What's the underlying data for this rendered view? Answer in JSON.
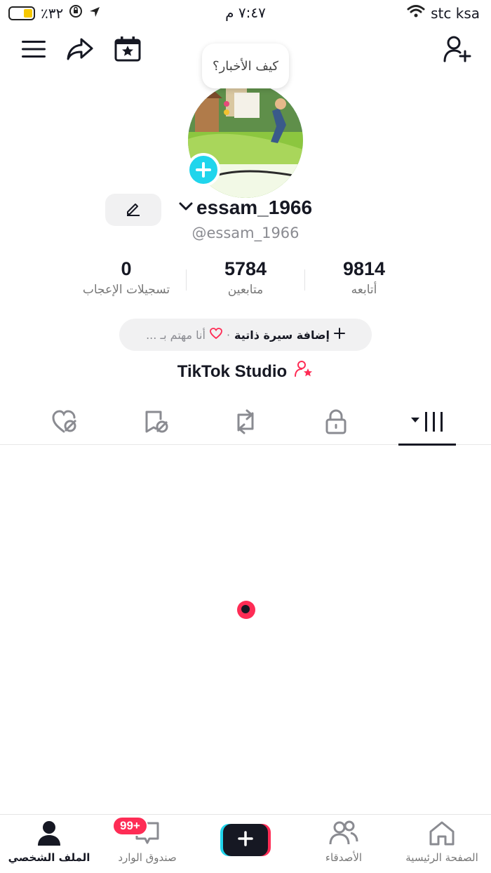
{
  "status_bar": {
    "battery": "٪٣٢",
    "time": "٧:٤٧ م",
    "carrier": "stc ksa"
  },
  "top_bar": {
    "menu_icon": "menu-icon",
    "share_icon": "share-icon",
    "calendar_icon": "calendar-star-icon",
    "add_friend_icon": "add-user-icon"
  },
  "profile": {
    "bubble_text": "كيف الأخبار؟",
    "username": "essam_1966",
    "handle": "@essam_1966",
    "stats": [
      {
        "value": "0",
        "label": "تسجيلات الإعجاب"
      },
      {
        "value": "5784",
        "label": "متابعين"
      },
      {
        "value": "9814",
        "label": "أتابعه"
      }
    ],
    "bio": {
      "add_label": "إضافة سيرة ذاتية",
      "separator": "·",
      "interest_label": "أنا مهتم بـ ..."
    },
    "studio_label": "TikTok Studio"
  },
  "tabs": [
    {
      "icon": "liked-hidden-icon"
    },
    {
      "icon": "favorites-hidden-icon"
    },
    {
      "icon": "repost-icon"
    },
    {
      "icon": "lock-icon"
    },
    {
      "icon": "videos-grid-icon"
    }
  ],
  "bottom_nav": {
    "profile_label": "الملف الشخصي",
    "inbox_label": "صندوق الوارد",
    "inbox_badge": "99+",
    "friends_label": "الأصدقاء",
    "home_label": "الصفحة الرئيسية"
  },
  "colors": {
    "accent": "#fe2c55",
    "cyan": "#20d5ec",
    "text": "#161823",
    "muted": "#8a8b91"
  }
}
